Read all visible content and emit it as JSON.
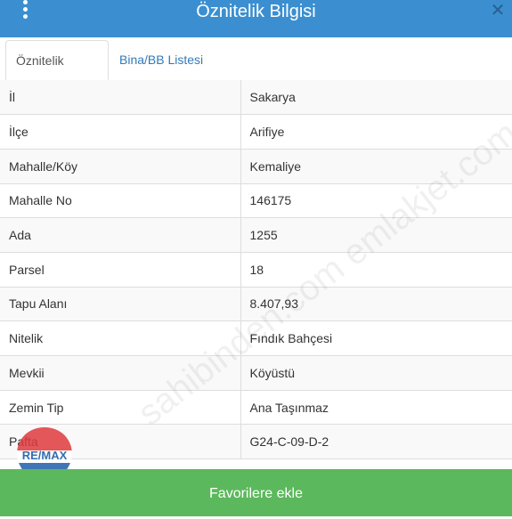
{
  "header": {
    "title": "Öznitelik Bilgisi",
    "menu_icon": "vertical-dots-icon",
    "close_icon": "close-icon"
  },
  "tabs": [
    {
      "label": "Öznitelik Bilgisi",
      "active": true
    },
    {
      "label": "Bina/BB Listesi",
      "active": false
    }
  ],
  "rows": [
    {
      "key": "İl",
      "value": "Sakarya"
    },
    {
      "key": "İlçe",
      "value": "Arifiye"
    },
    {
      "key": "Mahalle/Köy",
      "value": "Kemaliye"
    },
    {
      "key": "Mahalle No",
      "value": "146175"
    },
    {
      "key": "Ada",
      "value": "1255"
    },
    {
      "key": "Parsel",
      "value": "18"
    },
    {
      "key": "Tapu Alanı",
      "value": "8.407,93"
    },
    {
      "key": "Nitelik",
      "value": "Fındık Bahçesi"
    },
    {
      "key": "Mevkii",
      "value": "Köyüstü"
    },
    {
      "key": "Zemin Tip",
      "value": "Ana Taşınmaz"
    },
    {
      "key": "Pafta",
      "value": "G24-C-09-D-2"
    }
  ],
  "footer": {
    "button_label": "Favorilere ekle"
  },
  "watermark": {
    "text": "sahibinden.com emlakjet.com"
  },
  "logo": {
    "text": "RE/MAX"
  },
  "colors": {
    "header": "#3b8fd0",
    "footer": "#5cb85c",
    "tab_link": "#337ab7"
  }
}
